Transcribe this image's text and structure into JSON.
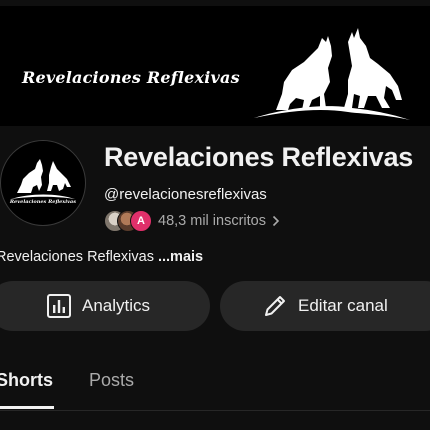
{
  "banner": {
    "title": "Revelaciones Reflexivas",
    "art_icon": "howling-wolves-icon"
  },
  "channel": {
    "avatar_icon": "howling-wolves-icon",
    "avatar_text": "Revelaciones Reflexivas",
    "name": "Revelaciones Reflexivas",
    "handle": "@revelacionesreflexivas",
    "subscribers": "48,3 mil inscritos",
    "subscriber_avatar_letter": "A",
    "description": "Revelaciones Reflexivas",
    "more_label": "...mais"
  },
  "actions": {
    "analytics_label": "Analytics",
    "analytics_icon": "bar-chart-icon",
    "edit_label": "Editar canal",
    "edit_icon": "pencil-icon"
  },
  "tabs": [
    {
      "label": "Shorts",
      "selected": true
    },
    {
      "label": "Posts",
      "selected": false
    }
  ],
  "colors": {
    "background": "#0f0f0f",
    "button_bg": "#272727",
    "text_primary": "#f1f1f1",
    "text_secondary": "#aaaaaa",
    "badge_pink": "#e0306a"
  }
}
